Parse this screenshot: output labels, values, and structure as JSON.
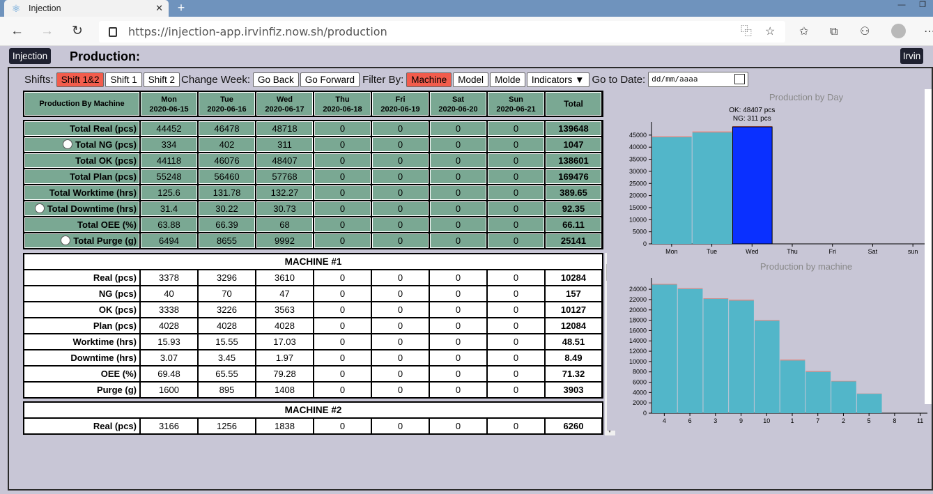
{
  "browser": {
    "tab_title": "Injection",
    "url": "https://injection-app.irvinfiz.now.sh/production"
  },
  "app": {
    "brand": "Injection",
    "page_title": "Production:",
    "user": "Irvin"
  },
  "filters": {
    "shifts_label": "Shifts:",
    "shifts": [
      "Shift 1&2",
      "Shift 1",
      "Shift 2"
    ],
    "shift_active": "Shift 1&2",
    "change_week_label": "Change Week:",
    "go_back": "Go Back",
    "go_forward": "Go Forward",
    "filter_by_label": "Filter By:",
    "filter_options": [
      "Machine",
      "Model",
      "Molde"
    ],
    "filter_active": "Machine",
    "indicators": "Indicators ▼",
    "goto_label": "Go to Date:",
    "date_placeholder": "dd/mm/aaaa"
  },
  "table": {
    "corner": "Production By Machine",
    "days": [
      {
        "name": "Mon",
        "date": "2020-06-15"
      },
      {
        "name": "Tue",
        "date": "2020-06-16"
      },
      {
        "name": "Wed",
        "date": "2020-06-17"
      },
      {
        "name": "Thu",
        "date": "2020-06-18"
      },
      {
        "name": "Fri",
        "date": "2020-06-19"
      },
      {
        "name": "Sat",
        "date": "2020-06-20"
      },
      {
        "name": "Sun",
        "date": "2020-06-21"
      }
    ],
    "total_header": "Total",
    "totals": [
      {
        "label": "Total Real (pcs)",
        "toggle": false,
        "values": [
          "44452",
          "46478",
          "48718",
          "0",
          "0",
          "0",
          "0"
        ],
        "total": "139648"
      },
      {
        "label": "Total NG (pcs)",
        "toggle": true,
        "values": [
          "334",
          "402",
          "311",
          "0",
          "0",
          "0",
          "0"
        ],
        "total": "1047"
      },
      {
        "label": "Total OK (pcs)",
        "toggle": false,
        "values": [
          "44118",
          "46076",
          "48407",
          "0",
          "0",
          "0",
          "0"
        ],
        "total": "138601"
      },
      {
        "label": "Total Plan (pcs)",
        "toggle": false,
        "values": [
          "55248",
          "56460",
          "57768",
          "0",
          "0",
          "0",
          "0"
        ],
        "total": "169476"
      },
      {
        "label": "Total Worktime (hrs)",
        "toggle": false,
        "values": [
          "125.6",
          "131.78",
          "132.27",
          "0",
          "0",
          "0",
          "0"
        ],
        "total": "389.65"
      },
      {
        "label": "Total Downtime (hrs)",
        "toggle": true,
        "values": [
          "31.4",
          "30.22",
          "30.73",
          "0",
          "0",
          "0",
          "0"
        ],
        "total": "92.35"
      },
      {
        "label": "Total OEE (%)",
        "toggle": false,
        "values": [
          "63.88",
          "66.39",
          "68",
          "0",
          "0",
          "0",
          "0"
        ],
        "total": "66.11"
      },
      {
        "label": "Total Purge (g)",
        "toggle": true,
        "values": [
          "6494",
          "8655",
          "9992",
          "0",
          "0",
          "0",
          "0"
        ],
        "total": "25141"
      }
    ],
    "machines": [
      {
        "title": "MACHINE #1",
        "rows": [
          {
            "label": "Real (pcs)",
            "values": [
              "3378",
              "3296",
              "3610",
              "0",
              "0",
              "0",
              "0"
            ],
            "total": "10284"
          },
          {
            "label": "NG (pcs)",
            "values": [
              "40",
              "70",
              "47",
              "0",
              "0",
              "0",
              "0"
            ],
            "total": "157"
          },
          {
            "label": "OK (pcs)",
            "values": [
              "3338",
              "3226",
              "3563",
              "0",
              "0",
              "0",
              "0"
            ],
            "total": "10127"
          },
          {
            "label": "Plan (pcs)",
            "values": [
              "4028",
              "4028",
              "4028",
              "0",
              "0",
              "0",
              "0"
            ],
            "total": "12084"
          },
          {
            "label": "Worktime (hrs)",
            "values": [
              "15.93",
              "15.55",
              "17.03",
              "0",
              "0",
              "0",
              "0"
            ],
            "total": "48.51"
          },
          {
            "label": "Downtime (hrs)",
            "values": [
              "3.07",
              "3.45",
              "1.97",
              "0",
              "0",
              "0",
              "0"
            ],
            "total": "8.49"
          },
          {
            "label": "OEE (%)",
            "values": [
              "69.48",
              "65.55",
              "79.28",
              "0",
              "0",
              "0",
              "0"
            ],
            "total": "71.32"
          },
          {
            "label": "Purge (g)",
            "values": [
              "1600",
              "895",
              "1408",
              "0",
              "0",
              "0",
              "0"
            ],
            "total": "3903"
          }
        ]
      },
      {
        "title": "MACHINE #2",
        "rows": [
          {
            "label": "Real (pcs)",
            "values": [
              "3166",
              "1256",
              "1838",
              "0",
              "0",
              "0",
              "0"
            ],
            "total": "6260"
          }
        ]
      }
    ]
  },
  "chart_data": [
    {
      "type": "bar",
      "title": "Production by Day",
      "categories": [
        "Mon",
        "Tue",
        "Wed",
        "Thu",
        "Fri",
        "Sat",
        "sun"
      ],
      "series": [
        {
          "name": "OK",
          "values": [
            44118,
            46076,
            48407,
            0,
            0,
            0,
            0
          ]
        },
        {
          "name": "NG",
          "values": [
            334,
            402,
            311,
            0,
            0,
            0,
            0
          ]
        }
      ],
      "highlight_index": 2,
      "tooltip": {
        "ok": "OK: 48407 pcs",
        "ng": "NG: 311 pcs"
      },
      "ylim": [
        0,
        49000
      ],
      "yticks": [
        0,
        5000,
        10000,
        15000,
        20000,
        25000,
        30000,
        35000,
        40000,
        45000
      ],
      "colors": {
        "ok": "#52b6c9",
        "ng": "#e87a6e",
        "highlight": "#0a30ff"
      }
    },
    {
      "type": "bar",
      "title": "Production by machine",
      "categories": [
        "4",
        "6",
        "3",
        "9",
        "10",
        "1",
        "7",
        "2",
        "5",
        "8",
        "11"
      ],
      "series": [
        {
          "name": "OK",
          "values": [
            24900,
            24050,
            22150,
            21800,
            17900,
            10200,
            8000,
            6150,
            3750,
            0,
            0
          ]
        },
        {
          "name": "NG",
          "values": [
            120,
            140,
            100,
            160,
            130,
            157,
            150,
            90,
            60,
            0,
            0
          ]
        }
      ],
      "ylim": [
        0,
        25500
      ],
      "yticks": [
        0,
        2000,
        4000,
        6000,
        8000,
        10000,
        12000,
        14000,
        16000,
        18000,
        20000,
        22000,
        24000
      ],
      "colors": {
        "ok": "#52b6c9",
        "ng": "#e87a6e"
      }
    }
  ]
}
